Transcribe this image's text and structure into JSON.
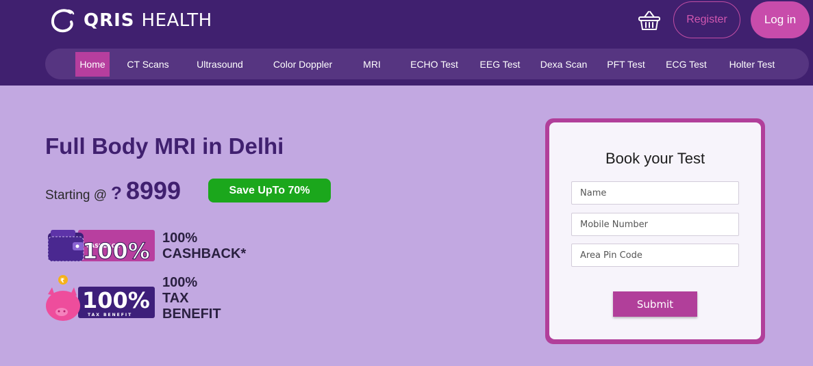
{
  "brand": {
    "name_bold": "QRIS",
    "name_light": "HEALTH"
  },
  "header": {
    "register_label": "Register",
    "login_label": "Log in",
    "cart_icon": "basket-icon"
  },
  "nav": {
    "items": [
      {
        "label": "Home",
        "active": true
      },
      {
        "label": "CT Scans"
      },
      {
        "label": "Ultrasound"
      },
      {
        "label": "Color Doppler"
      },
      {
        "label": "MRI"
      },
      {
        "label": "ECHO Test"
      },
      {
        "label": "EEG Test"
      },
      {
        "label": "Dexa Scan"
      },
      {
        "label": "PFT Test"
      },
      {
        "label": "ECG Test"
      },
      {
        "label": "Holter Test"
      }
    ]
  },
  "hero": {
    "title": "Full Body MRI in Delhi",
    "starting_label": "Starting @",
    "currency_glyph": "?",
    "price": "8999",
    "save_badge": "Save UpTo 70%",
    "benefits": [
      {
        "badge_value": "100%",
        "badge_caption": "CASHBACK",
        "label": "100% CASHBACK*",
        "icon": "wallet-icon"
      },
      {
        "badge_value": "100%",
        "badge_caption": "TAX BENEFIT",
        "label": "100% TAX BENEFIT",
        "icon": "piggy-bank-icon"
      }
    ]
  },
  "booking": {
    "title": "Book your Test",
    "name_placeholder": "Name",
    "mobile_placeholder": "Mobile Number",
    "pin_placeholder": "Area Pin Code",
    "submit_label": "Submit"
  },
  "colors": {
    "header_bg": "#40206f",
    "nav_bg": "#563581",
    "accent": "#b63e9e",
    "page_bg": "#c2a8e1",
    "save_green": "#1ba71c"
  }
}
